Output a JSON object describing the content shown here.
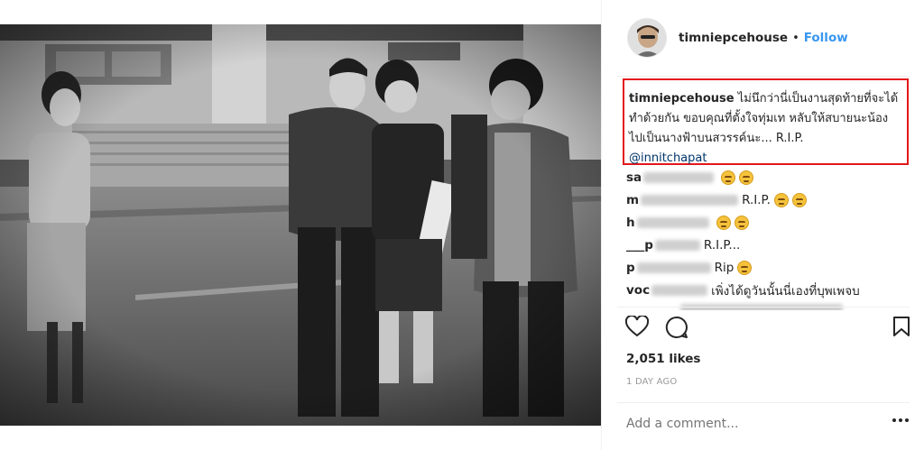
{
  "post": {
    "username": "timniepcehouse",
    "follow_label": "Follow",
    "separator": "•"
  },
  "caption": {
    "username": "timniepcehouse",
    "text": "ไม่นึกว่านี่เป็นงานสุดท้ายที่จะได้ทำด้วยกัน ขอบคุณที่ตั้งใจทุ่มเท หลับให้สบายนะน้อง ไปเป็นนางฟ้าบนสวรรค์นะ... R.I.P.",
    "mention": "@innitchapat",
    "highlight_color": "#e3171b"
  },
  "comments": [
    {
      "user": "sa",
      "text": ""
    },
    {
      "user": "m",
      "text": "R.I.P."
    },
    {
      "user": "h",
      "text": ""
    },
    {
      "user": "___p",
      "text": "R.I.P..."
    },
    {
      "user": "p",
      "text": "Rip"
    },
    {
      "user": "voc",
      "text": "เพิ่งได้ดูวันนั้นนี่เองที่บุพเพจบ"
    }
  ],
  "likes": "2,051 likes",
  "timestamp": "1 DAY AGO",
  "add_comment_placeholder": "Add a comment...",
  "colors": {
    "link": "#3897f0",
    "mention": "#003569",
    "muted": "#999999"
  }
}
